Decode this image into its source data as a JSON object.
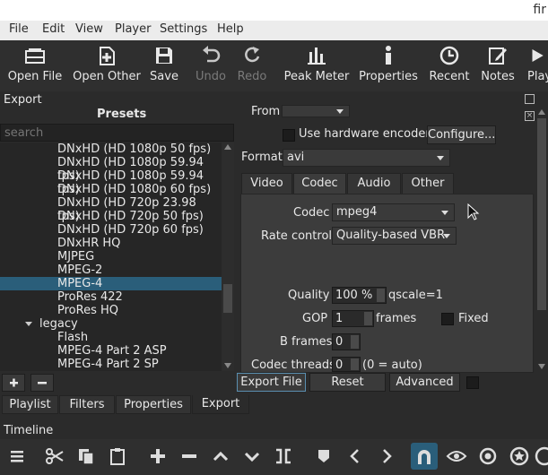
{
  "window": {
    "title_fragment": "fir"
  },
  "menu": [
    "File",
    "Edit",
    "View",
    "Player",
    "Settings",
    "Help"
  ],
  "toolbar": [
    {
      "label": "Open File",
      "icon": "open-file-icon",
      "enabled": true
    },
    {
      "label": "Open Other",
      "icon": "open-other-icon",
      "enabled": true
    },
    {
      "label": "Save",
      "icon": "save-icon",
      "enabled": true
    },
    {
      "label": "Undo",
      "icon": "undo-icon",
      "enabled": false
    },
    {
      "label": "Redo",
      "icon": "redo-icon",
      "enabled": false
    },
    {
      "label": "Peak Meter",
      "icon": "peak-meter-icon",
      "enabled": true
    },
    {
      "label": "Properties",
      "icon": "properties-icon",
      "enabled": true
    },
    {
      "label": "Recent",
      "icon": "recent-icon",
      "enabled": true
    },
    {
      "label": "Notes",
      "icon": "notes-icon",
      "enabled": true
    },
    {
      "label": "Play",
      "icon": "playlist-icon",
      "enabled": true
    }
  ],
  "export": {
    "title": "Export",
    "presets_label": "Presets",
    "search_placeholder": "search",
    "presets": [
      {
        "label": "DNxHD (HD 1080p 50 fps)",
        "level": 1
      },
      {
        "label": "DNxHD (HD 1080p 59.94 fps)",
        "level": 1
      },
      {
        "label": "DNxHD (HD 1080p 59.94 fps)",
        "level": 1
      },
      {
        "label": "DNxHD (HD 1080p 60 fps)",
        "level": 1
      },
      {
        "label": "DNxHD (HD 720p 23.98 fps)",
        "level": 1
      },
      {
        "label": "DNxHD (HD 720p 50 fps)",
        "level": 1
      },
      {
        "label": "DNxHD (HD 720p 60 fps)",
        "level": 1
      },
      {
        "label": "DNxHR HQ",
        "level": 1
      },
      {
        "label": "MJPEG",
        "level": 1
      },
      {
        "label": "MPEG-2",
        "level": 1
      },
      {
        "label": "MPEG-4",
        "level": 1,
        "selected": true
      },
      {
        "label": "ProRes 422",
        "level": 1
      },
      {
        "label": "ProRes HQ",
        "level": 1
      },
      {
        "label": "legacy",
        "level": 0,
        "expanded": true
      },
      {
        "label": "Flash",
        "level": 1
      },
      {
        "label": "MPEG-4 Part 2 ASP",
        "level": 1
      },
      {
        "label": "MPEG-4 Part 2 SP",
        "level": 1
      }
    ],
    "from_label": "From",
    "from_value": "",
    "use_hw_encoder": "Use hardware encoder",
    "configure": "Configure...",
    "format_label": "Format",
    "format_value": "avi",
    "tabs": [
      "Video",
      "Codec",
      "Audio",
      "Other"
    ],
    "active_tab": "Codec",
    "codec_label": "Codec",
    "codec_value": "mpeg4",
    "rate_control_label": "Rate control",
    "rate_control_value": "Quality-based VBR",
    "quality_label": "Quality",
    "quality_value": "100 %",
    "qscale": "qscale=1",
    "gop_label": "GOP",
    "gop_value": "1",
    "gop_unit": "frames",
    "fixed_label": "Fixed",
    "bframes_label": "B frames",
    "bframes_value": "0",
    "codec_threads_label": "Codec threads",
    "codec_threads_value": "0",
    "codec_threads_note": "(0 = auto)",
    "export_file": "Export File",
    "reset": "Reset",
    "advanced": "Advanced"
  },
  "dock_tabs": [
    "Playlist",
    "Filters",
    "Properties",
    "Export"
  ],
  "active_dock_tab": "Export",
  "timeline": {
    "title": "Timeline"
  },
  "timeline_toolbar": [
    "menu-icon",
    "cut-icon",
    "copy-icon",
    "paste-icon",
    "append-icon",
    "remove-icon",
    "lift-icon",
    "overwrite-icon",
    "split-icon",
    "marker-icon",
    "prev-icon",
    "next-icon",
    "snap-icon",
    "scrub-icon",
    "ripple-icon",
    "ripple-all-icon",
    "more-icon"
  ]
}
